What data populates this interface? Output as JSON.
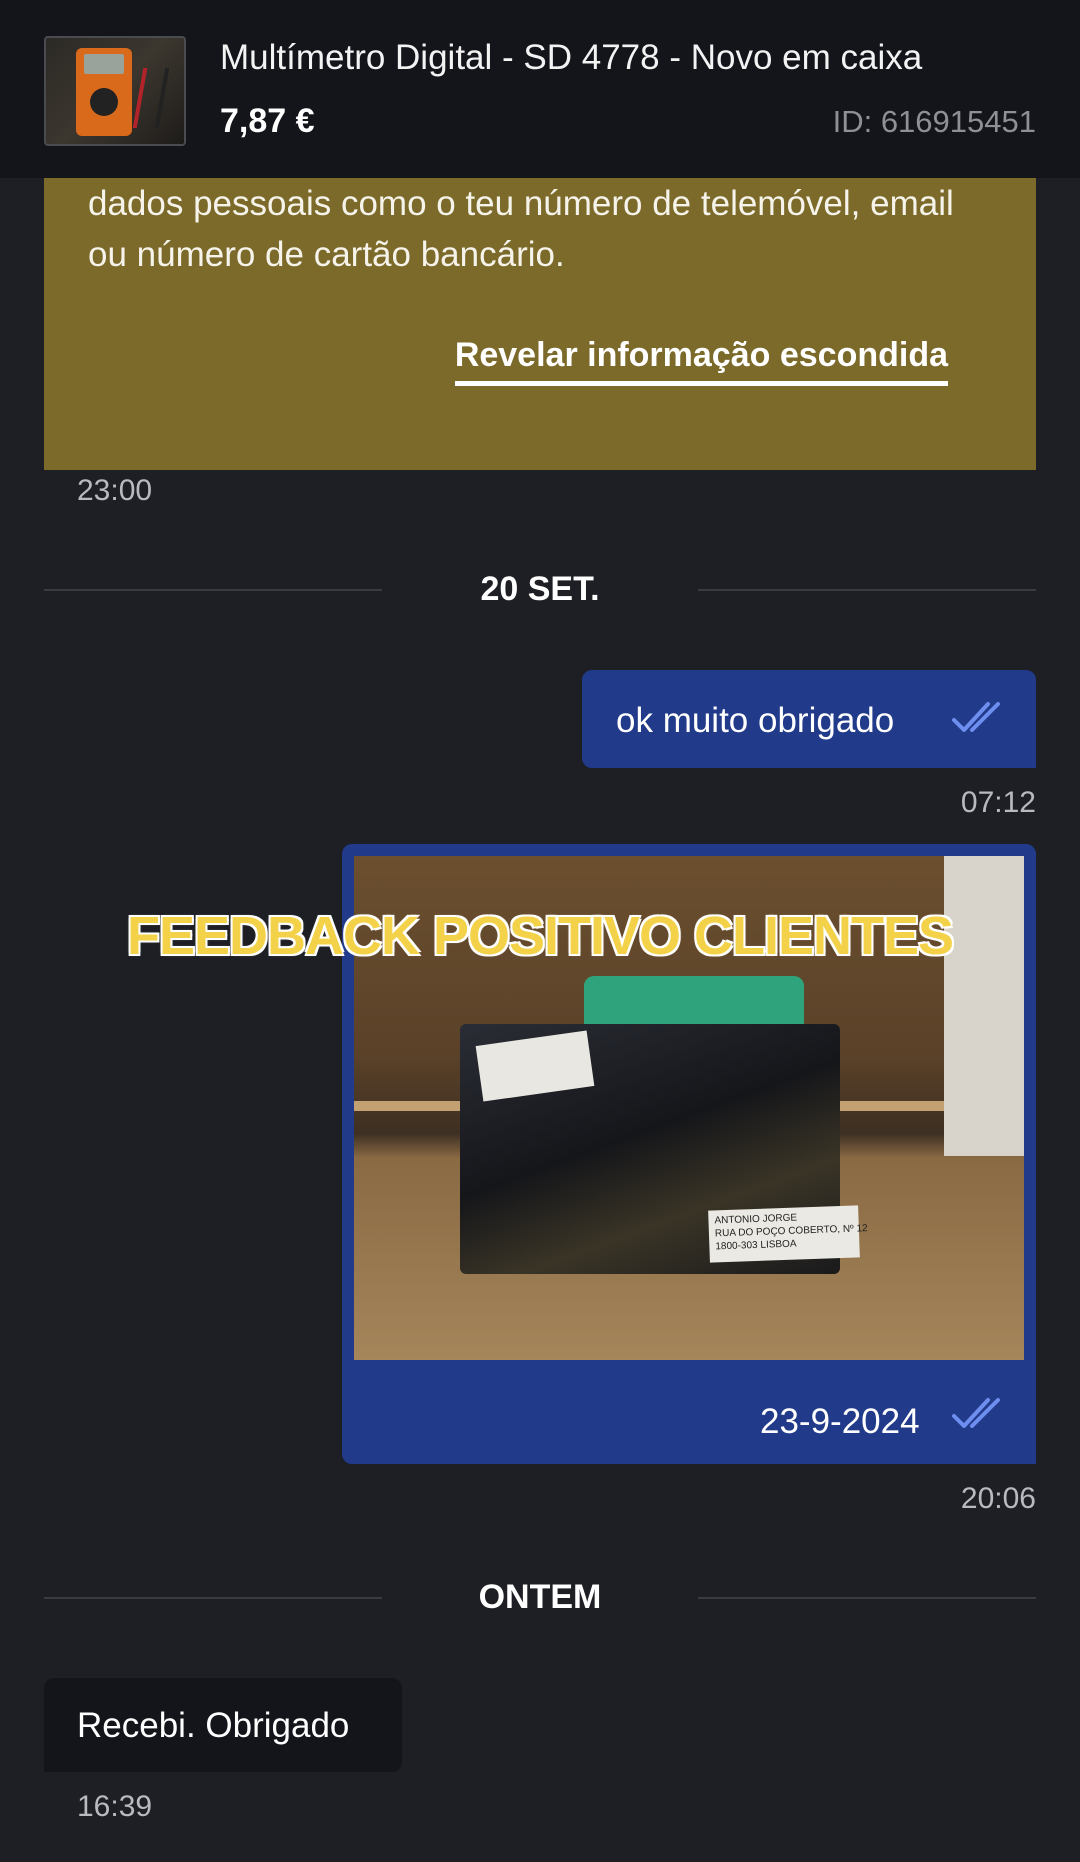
{
  "header": {
    "product_title": "Multímetro Digital - SD 4778  - Novo em caixa",
    "price": "7,87 €",
    "listing_id": "ID: 616915451"
  },
  "warning": {
    "text": "dados pessoais como o teu número de telemóvel, email ou número de cartão bancário.",
    "reveal_link": "Revelar informação escondida",
    "time": "23:00"
  },
  "dividers": {
    "first": "20 SET.",
    "second": "ONTEM"
  },
  "messages": {
    "sent_text": "ok muito obrigado",
    "sent_text_time": "07:12",
    "sent_photo_caption": "23-9-2024",
    "sent_photo_time": "20:06",
    "photo_label_address": "ANTONIO JORGE\nRUA DO POÇO COBERTO, Nº 12\n1800-303 LISBOA",
    "received_text": "Recebi. Obrigado",
    "received_time": "16:39"
  },
  "overlay_banner": "FEEDBACK POSITIVO CLIENTES",
  "colors": {
    "background": "#1e1f24",
    "header": "#13151b",
    "warning": "#7c6a2a",
    "sent_bubble": "#213a89",
    "read_check": "#6f8ff0",
    "banner": "#f3d24a"
  }
}
